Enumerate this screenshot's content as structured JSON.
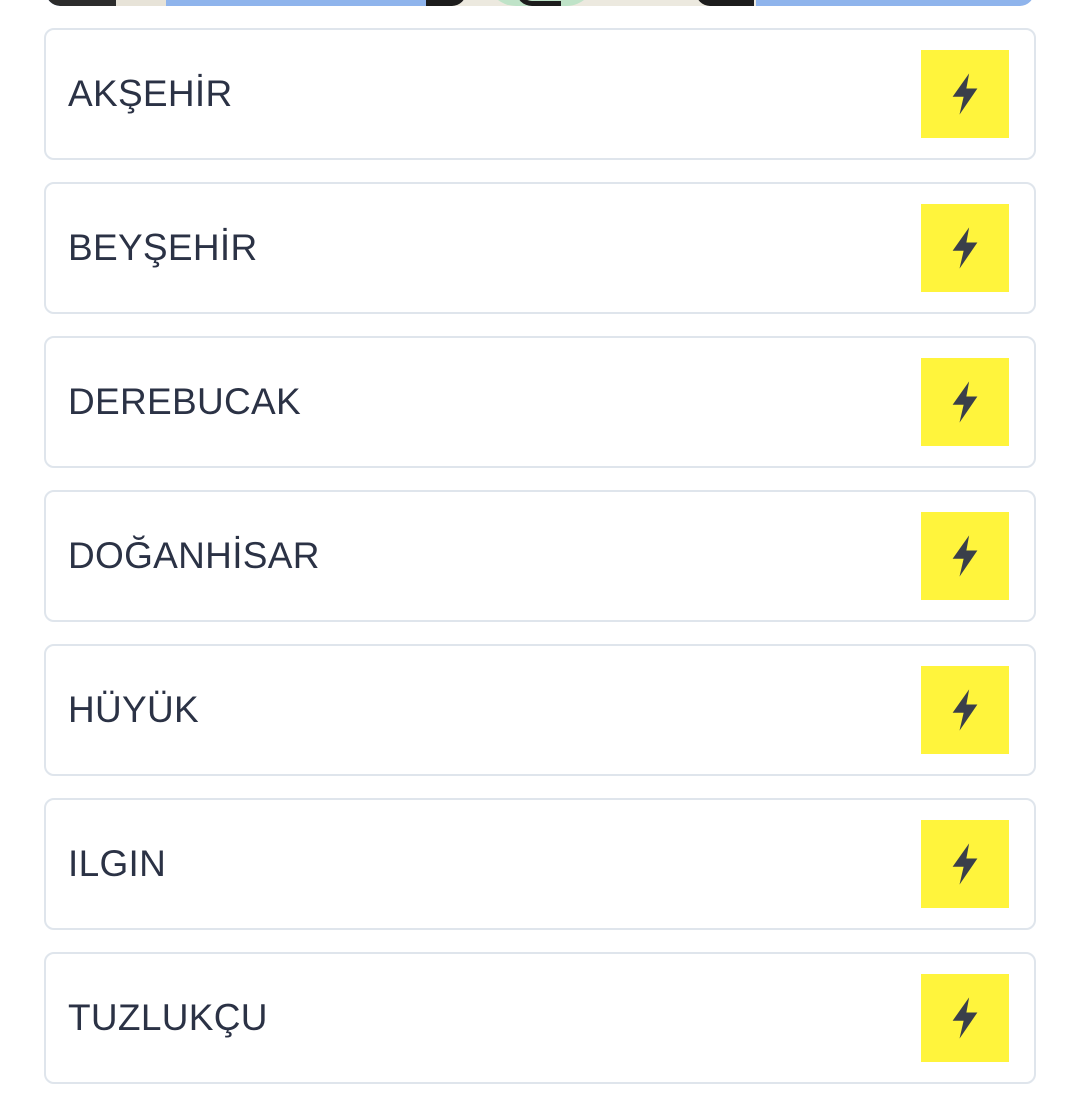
{
  "colors": {
    "accent_yellow": "#fff43c",
    "card_border": "#dfe5ec",
    "label_text": "#2b3245",
    "icon_color": "#3a3f4a",
    "map_blue": "#8fb4ec"
  },
  "districts": [
    {
      "label": "AKŞEHİR",
      "icon": "lightning-bolt-icon"
    },
    {
      "label": "BEYŞEHİR",
      "icon": "lightning-bolt-icon"
    },
    {
      "label": "DEREBUCAK",
      "icon": "lightning-bolt-icon"
    },
    {
      "label": "DOĞANHİSAR",
      "icon": "lightning-bolt-icon"
    },
    {
      "label": "HÜYÜK",
      "icon": "lightning-bolt-icon"
    },
    {
      "label": "ILGIN",
      "icon": "lightning-bolt-icon"
    },
    {
      "label": "TUZLUKÇU",
      "icon": "lightning-bolt-icon"
    }
  ]
}
